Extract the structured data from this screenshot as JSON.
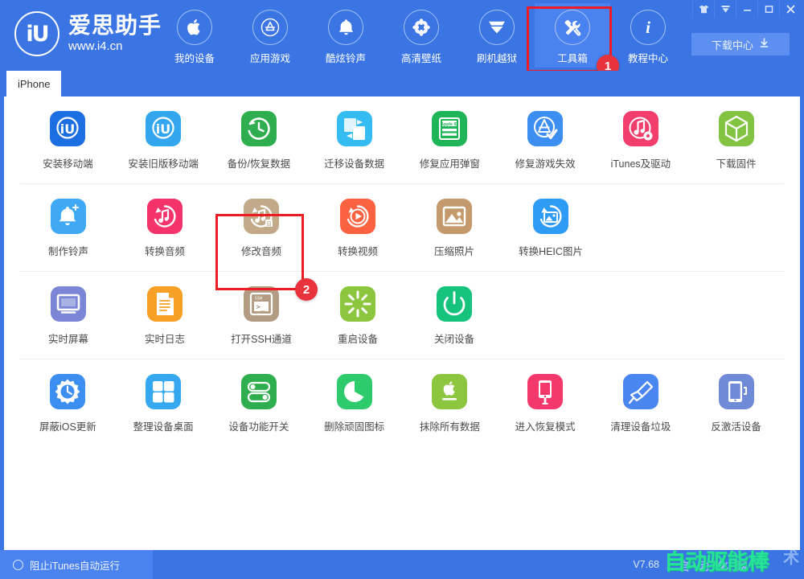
{
  "window": {
    "controls": [
      {
        "name": "theme-skin",
        "glyph": "skin"
      },
      {
        "name": "menu-dropdown",
        "glyph": "caret"
      },
      {
        "name": "minimize",
        "glyph": "minimize"
      },
      {
        "name": "maximize",
        "glyph": "maximize"
      },
      {
        "name": "close",
        "glyph": "close"
      }
    ]
  },
  "brand": {
    "mark": "iU",
    "name": "爱思助手",
    "url": "www.i4.cn"
  },
  "nav": {
    "items": [
      {
        "label": "我的设备",
        "icon": "apple-icon",
        "active": false
      },
      {
        "label": "应用游戏",
        "icon": "appstore-icon",
        "active": false
      },
      {
        "label": "酷炫铃声",
        "icon": "bell-icon",
        "active": false
      },
      {
        "label": "高清壁纸",
        "icon": "flower-icon",
        "active": false
      },
      {
        "label": "刷机越狱",
        "icon": "box-open-icon",
        "active": false
      },
      {
        "label": "工具箱",
        "icon": "tools-icon",
        "active": true
      },
      {
        "label": "教程中心",
        "icon": "info-icon",
        "active": false
      }
    ]
  },
  "download_center": {
    "label": "下载中心",
    "icon": "download-icon"
  },
  "tabs": [
    {
      "label": "iPhone",
      "active": true
    }
  ],
  "highlights": [
    {
      "badge": "1",
      "target": "工具箱",
      "color": "#ed1c24"
    },
    {
      "badge": "2",
      "target": "备份/恢复数据",
      "color": "#ed1c24"
    }
  ],
  "toolbox": {
    "rows": [
      [
        {
          "label": "安装移动端",
          "icon": "iu-app-icon",
          "color": "#1b6fe0"
        },
        {
          "label": "安装旧版移动端",
          "icon": "iu-app-old-icon",
          "color": "#32a7ef"
        },
        {
          "label": "备份/恢复数据",
          "icon": "backup-restore-icon",
          "color": "#2eae4e"
        },
        {
          "label": "迁移设备数据",
          "icon": "migrate-data-icon",
          "color": "#35bdf3"
        },
        {
          "label": "修复应用弹窗",
          "icon": "appleid-fix-icon",
          "color": "#1fb457"
        },
        {
          "label": "修复游戏失效",
          "icon": "fix-game-icon",
          "color": "#3c8ef0"
        },
        {
          "label": "iTunes及驱动",
          "icon": "itunes-driver-icon",
          "color": "#f23e6d"
        },
        {
          "label": "下载固件",
          "icon": "firmware-icon",
          "color": "#82c341"
        }
      ],
      [
        {
          "label": "制作铃声",
          "icon": "make-ringtone-icon",
          "color": "#3fa9f5"
        },
        {
          "label": "转换音频",
          "icon": "convert-audio-icon",
          "color": "#f5336b"
        },
        {
          "label": "修改音频",
          "icon": "edit-audio-icon",
          "color": "#c2a989"
        },
        {
          "label": "转换视频",
          "icon": "convert-video-icon",
          "color": "#fb6340"
        },
        {
          "label": "压缩照片",
          "icon": "compress-photo-icon",
          "color": "#c49a6c"
        },
        {
          "label": "转换HEIC图片",
          "icon": "heic-convert-icon",
          "color": "#2e9bf5"
        }
      ],
      [
        {
          "label": "实时屏幕",
          "icon": "live-screen-icon",
          "color": "#7b86d6"
        },
        {
          "label": "实时日志",
          "icon": "live-log-icon",
          "color": "#f6a026"
        },
        {
          "label": "打开SSH通道",
          "icon": "ssh-tunnel-icon",
          "color": "#b39c82"
        },
        {
          "label": "重启设备",
          "icon": "reboot-device-icon",
          "color": "#8cc63f"
        },
        {
          "label": "关闭设备",
          "icon": "power-off-icon",
          "color": "#16c37c"
        }
      ],
      [
        {
          "label": "屏蔽iOS更新",
          "icon": "block-ios-update-icon",
          "color": "#3c8ef0"
        },
        {
          "label": "整理设备桌面",
          "icon": "organize-desktop-icon",
          "color": "#35a8f0"
        },
        {
          "label": "设备功能开关",
          "icon": "feature-toggle-icon",
          "color": "#2eae4e"
        },
        {
          "label": "删除顽固图标",
          "icon": "delete-icon-icon",
          "color": "#2ecb6d"
        },
        {
          "label": "抹除所有数据",
          "icon": "erase-all-icon",
          "color": "#8cc63f"
        },
        {
          "label": "进入恢复模式",
          "icon": "recovery-mode-icon",
          "color": "#f5386c"
        },
        {
          "label": "清理设备垃圾",
          "icon": "clean-junk-icon",
          "color": "#4a86f0"
        },
        {
          "label": "反激活设备",
          "icon": "deactivate-icon",
          "color": "#6f8ad6"
        }
      ]
    ]
  },
  "statusbar": {
    "block_itunes_label": "阻止iTunes自动运行",
    "version": "V7.68",
    "watermark_main": "自动驱能棒",
    "watermark_sub": "自 动 化 网",
    "watermark_tail": "术"
  }
}
